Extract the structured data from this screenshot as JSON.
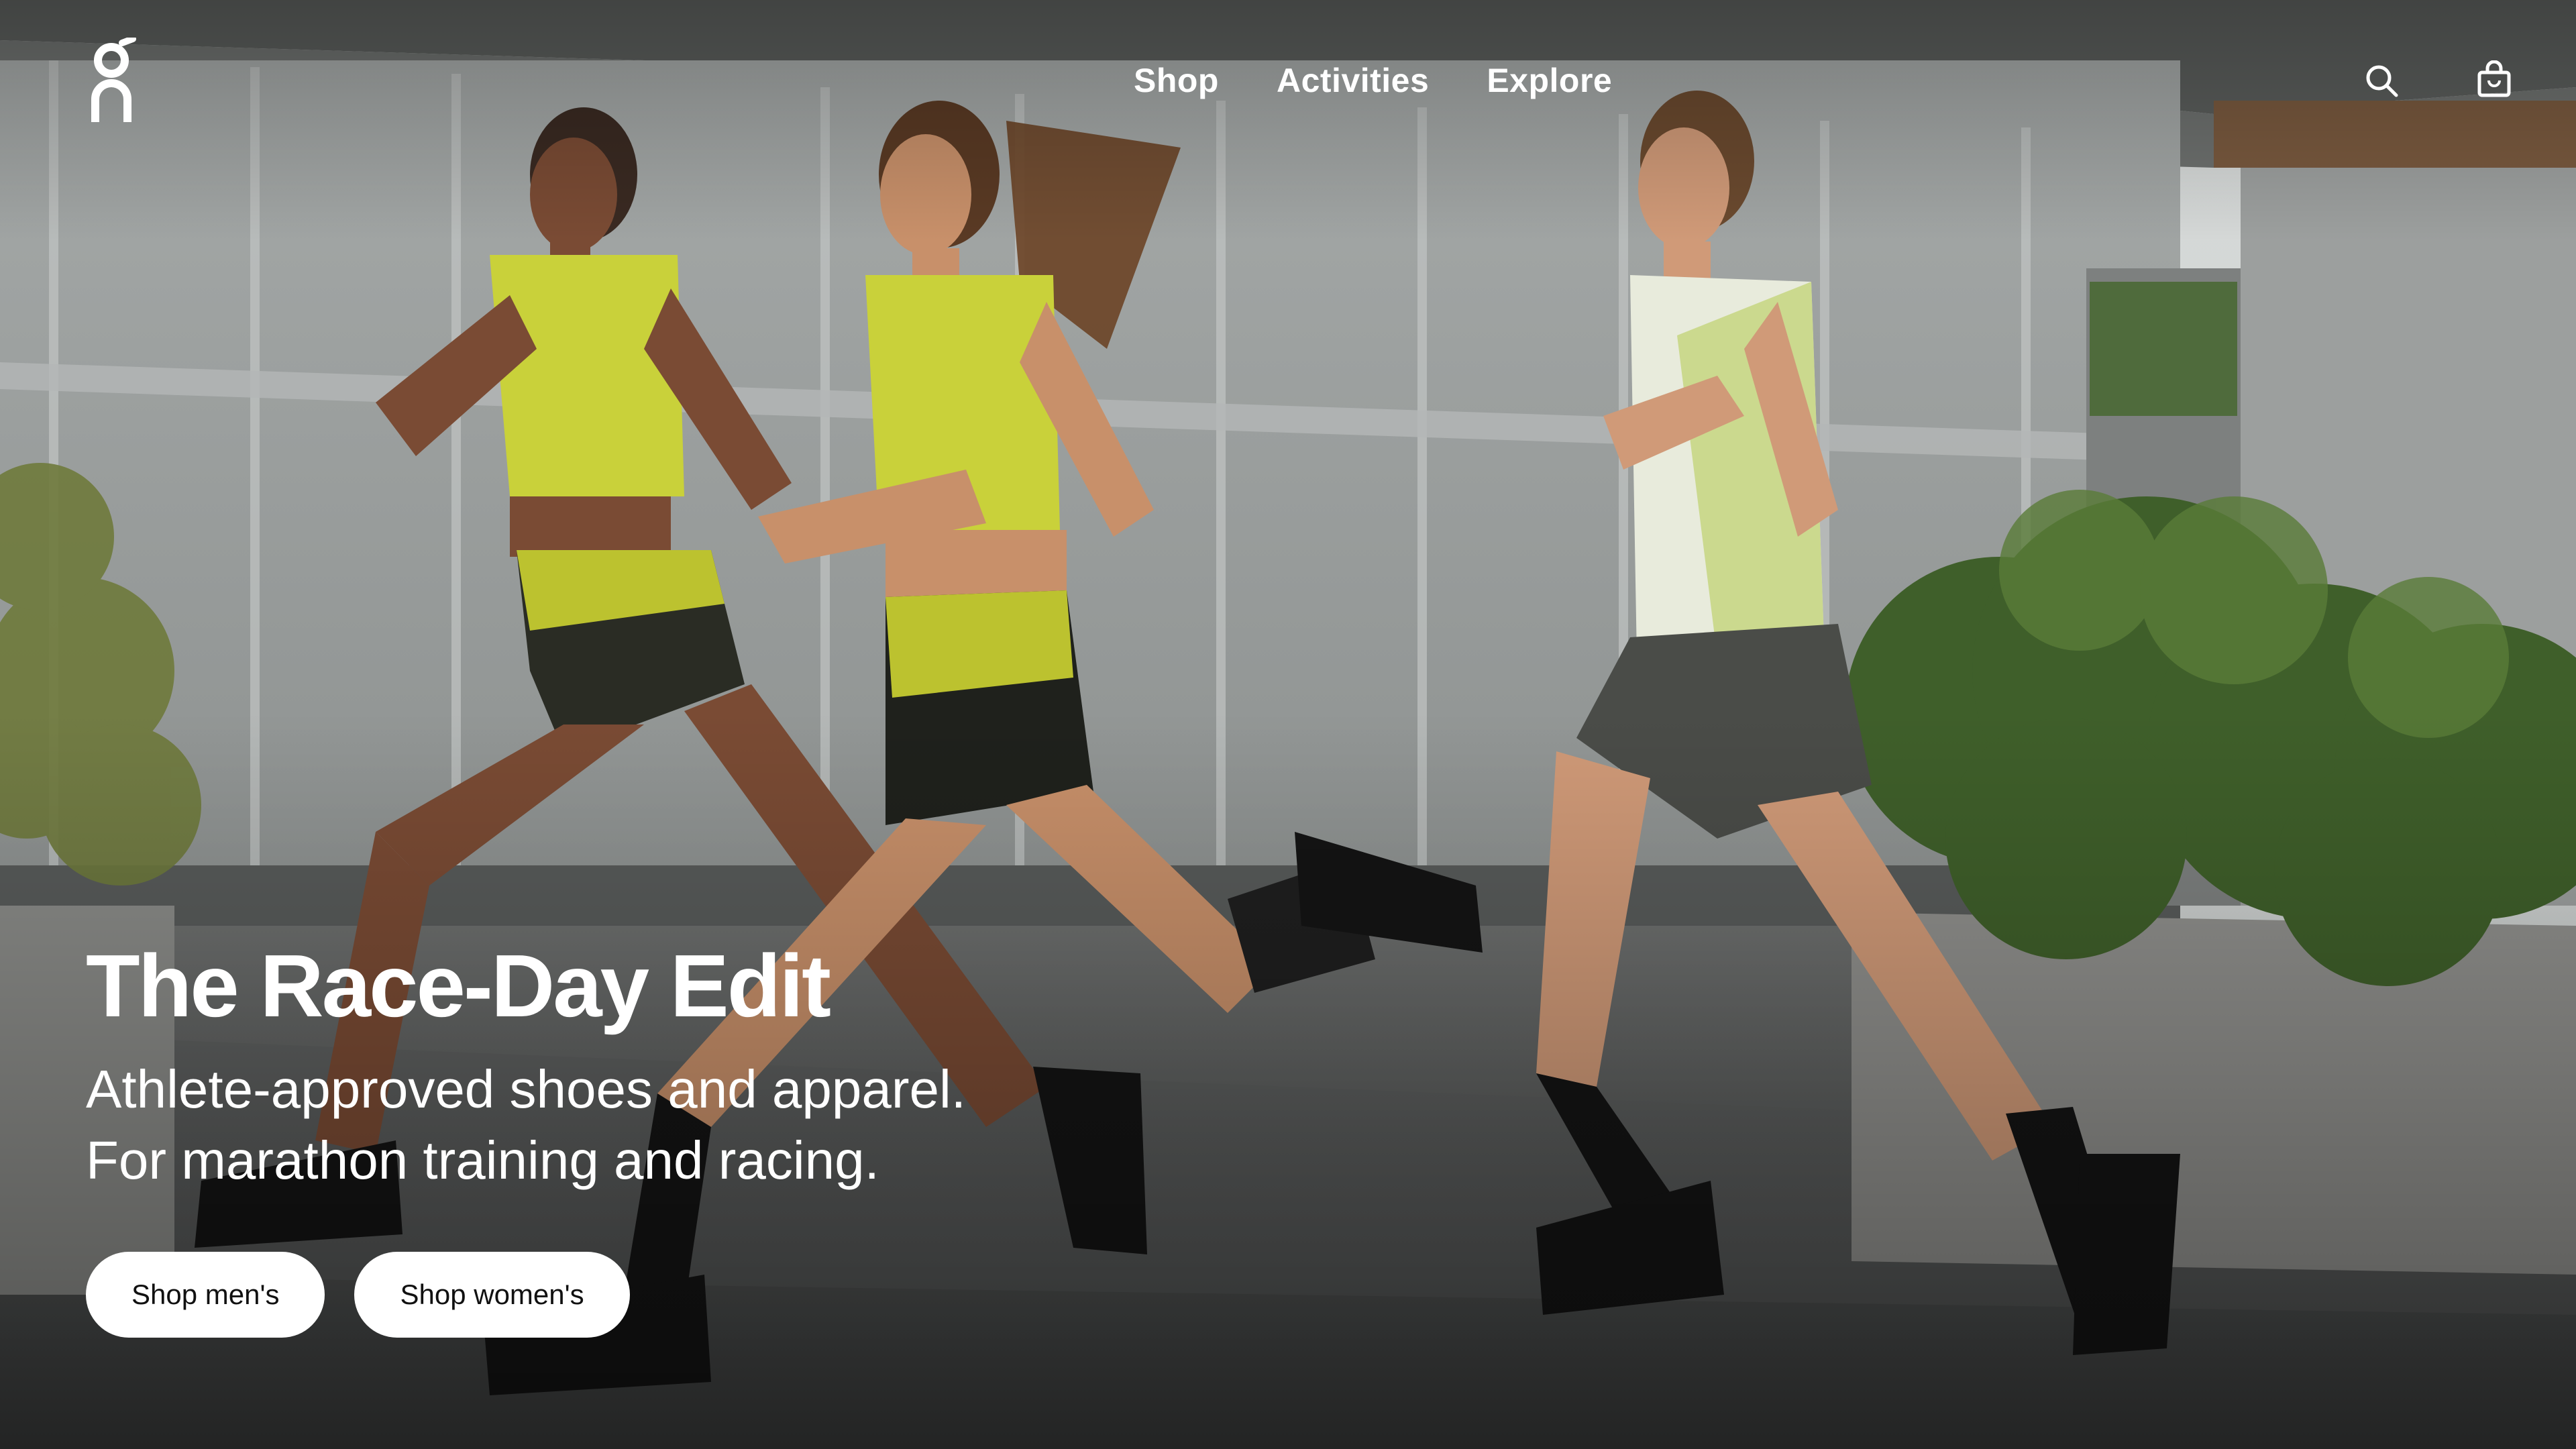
{
  "brand": {
    "logo_icon": "on-logo-icon"
  },
  "nav": {
    "items": [
      {
        "label": "Shop"
      },
      {
        "label": "Activities"
      },
      {
        "label": "Explore"
      }
    ]
  },
  "header_icons": {
    "search": "search-icon",
    "bag": "shopping-bag-icon",
    "account": "user-account-icon"
  },
  "hero": {
    "headline": "The Race-Day Edit",
    "subline_1": "Athlete-approved shoes and apparel.",
    "subline_2": "For marathon training and racing.",
    "buttons": [
      {
        "label": "Shop men's"
      },
      {
        "label": "Shop women's"
      }
    ]
  },
  "colors": {
    "text": "#ffffff",
    "button_bg": "#ffffff",
    "button_text": "#111111",
    "apparel_accent": "#c9d13a"
  }
}
